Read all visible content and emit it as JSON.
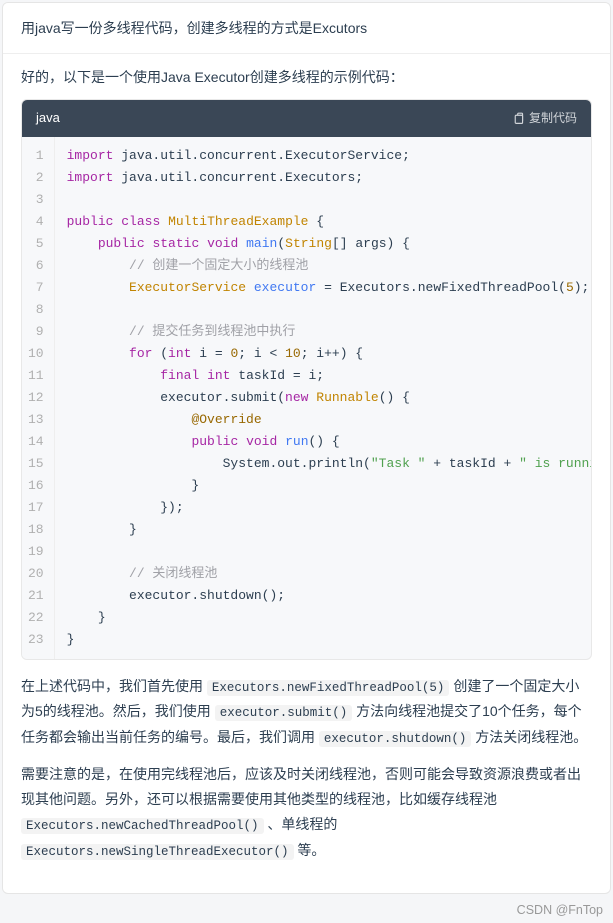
{
  "prompt": "用java写一份多线程代码，创建多线程的方式是Excutors",
  "response_intro": "好的，以下是一个使用Java Executor创建多线程的示例代码：",
  "code": {
    "lang_label": "java",
    "copy_label": "复制代码",
    "lines": [
      [
        [
          "kw",
          "import"
        ],
        [
          "",
          " java.util.concurrent.ExecutorService;"
        ]
      ],
      [
        [
          "kw",
          "import"
        ],
        [
          "",
          " java.util.concurrent.Executors;"
        ]
      ],
      [
        [
          "",
          ""
        ]
      ],
      [
        [
          "kw",
          "public"
        ],
        [
          "",
          " "
        ],
        [
          "kw",
          "class"
        ],
        [
          "",
          " "
        ],
        [
          "cls",
          "MultiThreadExample"
        ],
        [
          "",
          " {"
        ]
      ],
      [
        [
          "",
          "    "
        ],
        [
          "kw",
          "public"
        ],
        [
          "",
          " "
        ],
        [
          "kw",
          "static"
        ],
        [
          "",
          " "
        ],
        [
          "kw",
          "void"
        ],
        [
          "",
          " "
        ],
        [
          "fn",
          "main"
        ],
        [
          "",
          "("
        ],
        [
          "cls",
          "String"
        ],
        [
          "",
          "[] args) {"
        ]
      ],
      [
        [
          "",
          "        "
        ],
        [
          "cmt",
          "// 创建一个固定大小的线程池"
        ]
      ],
      [
        [
          "",
          "        "
        ],
        [
          "cls",
          "ExecutorService"
        ],
        [
          "",
          " "
        ],
        [
          "fn",
          "executor"
        ],
        [
          "",
          " = Executors.newFixedThreadPool("
        ],
        [
          "num",
          "5"
        ],
        [
          "",
          ");"
        ]
      ],
      [
        [
          "",
          ""
        ]
      ],
      [
        [
          "",
          "        "
        ],
        [
          "cmt",
          "// 提交任务到线程池中执行"
        ]
      ],
      [
        [
          "",
          "        "
        ],
        [
          "kw",
          "for"
        ],
        [
          "",
          " ("
        ],
        [
          "kw",
          "int"
        ],
        [
          "",
          " i = "
        ],
        [
          "num",
          "0"
        ],
        [
          "",
          "; i < "
        ],
        [
          "num",
          "10"
        ],
        [
          "",
          "; i++) {"
        ]
      ],
      [
        [
          "",
          "            "
        ],
        [
          "kw",
          "final"
        ],
        [
          "",
          " "
        ],
        [
          "kw",
          "int"
        ],
        [
          "",
          " taskId = i;"
        ]
      ],
      [
        [
          "",
          "            executor.submit("
        ],
        [
          "kw",
          "new"
        ],
        [
          "",
          " "
        ],
        [
          "cls",
          "Runnable"
        ],
        [
          "",
          "() {"
        ]
      ],
      [
        [
          "",
          "                "
        ],
        [
          "ann",
          "@Override"
        ]
      ],
      [
        [
          "",
          "                "
        ],
        [
          "kw",
          "public"
        ],
        [
          "",
          " "
        ],
        [
          "kw",
          "void"
        ],
        [
          "",
          " "
        ],
        [
          "fn",
          "run"
        ],
        [
          "",
          "() {"
        ]
      ],
      [
        [
          "",
          "                    System.out.println("
        ],
        [
          "str",
          "\"Task \""
        ],
        [
          "",
          " + taskId + "
        ],
        [
          "str",
          "\" is running.\""
        ],
        [
          "",
          ");"
        ]
      ],
      [
        [
          "",
          "                }"
        ]
      ],
      [
        [
          "",
          "            });"
        ]
      ],
      [
        [
          "",
          "        }"
        ]
      ],
      [
        [
          "",
          ""
        ]
      ],
      [
        [
          "",
          "        "
        ],
        [
          "cmt",
          "// 关闭线程池"
        ]
      ],
      [
        [
          "",
          "        executor.shutdown();"
        ]
      ],
      [
        [
          "",
          "    }"
        ]
      ],
      [
        [
          "",
          "}"
        ]
      ]
    ]
  },
  "para1_parts": [
    [
      "t",
      "在上述代码中，我们首先使用 "
    ],
    [
      "c",
      "Executors.newFixedThreadPool(5)"
    ],
    [
      "t",
      " 创建了一个固定大小为5的线程池。然后，我们使用 "
    ],
    [
      "c",
      "executor.submit()"
    ],
    [
      "t",
      " 方法向线程池提交了10个任务，每个任务都会输出当前任务的编号。最后，我们调用 "
    ],
    [
      "c",
      "executor.shutdown()"
    ],
    [
      "t",
      " 方法关闭线程池。"
    ]
  ],
  "para2_parts": [
    [
      "t",
      "需要注意的是，在使用完线程池后，应该及时关闭线程池，否则可能会导致资源浪费或者出现其他问题。另外，还可以根据需要使用其他类型的线程池，比如缓存线程池 "
    ],
    [
      "c",
      "Executors.newCachedThreadPool()"
    ],
    [
      "t",
      " 、单线程的 "
    ],
    [
      "c",
      "Executors.newSingleThreadExecutor()"
    ],
    [
      "t",
      " 等。"
    ]
  ],
  "footer": "CSDN @FnTop"
}
